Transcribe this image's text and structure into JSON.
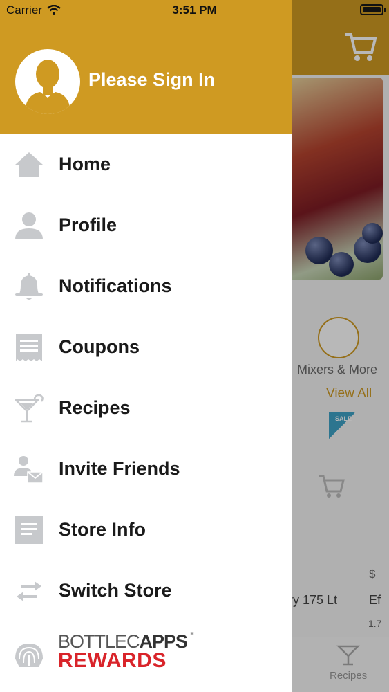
{
  "status_bar": {
    "carrier": "Carrier",
    "time": "3:51 PM"
  },
  "drawer": {
    "header": {
      "sign_in": "Please Sign In"
    },
    "menu": [
      {
        "label": "Home",
        "icon": "home-icon"
      },
      {
        "label": "Profile",
        "icon": "person-icon"
      },
      {
        "label": "Notifications",
        "icon": "bell-icon"
      },
      {
        "label": "Coupons",
        "icon": "coupon-icon"
      },
      {
        "label": "Recipes",
        "icon": "cocktail-icon"
      },
      {
        "label": "Invite Friends",
        "icon": "invite-icon"
      },
      {
        "label": "Store Info",
        "icon": "document-icon"
      },
      {
        "label": "Switch Store",
        "icon": "swap-arrows-icon"
      }
    ],
    "rewards": {
      "line1_a": "BOTTLEC",
      "line1_b": "APPS",
      "trademark": "™",
      "line2": "REWARDS"
    }
  },
  "background": {
    "category_label": "Mixers & More",
    "view_all": "View All",
    "sale_badge": "SALE",
    "price": "$",
    "product_name": "ry 175 Lt",
    "product_name_2": "Ef",
    "product_size": "1.7",
    "tab_label": "Recipes"
  },
  "colors": {
    "brand": "#cf9a22",
    "menu_icon": "#c7c9cc",
    "rewards_red": "#d9242a"
  }
}
